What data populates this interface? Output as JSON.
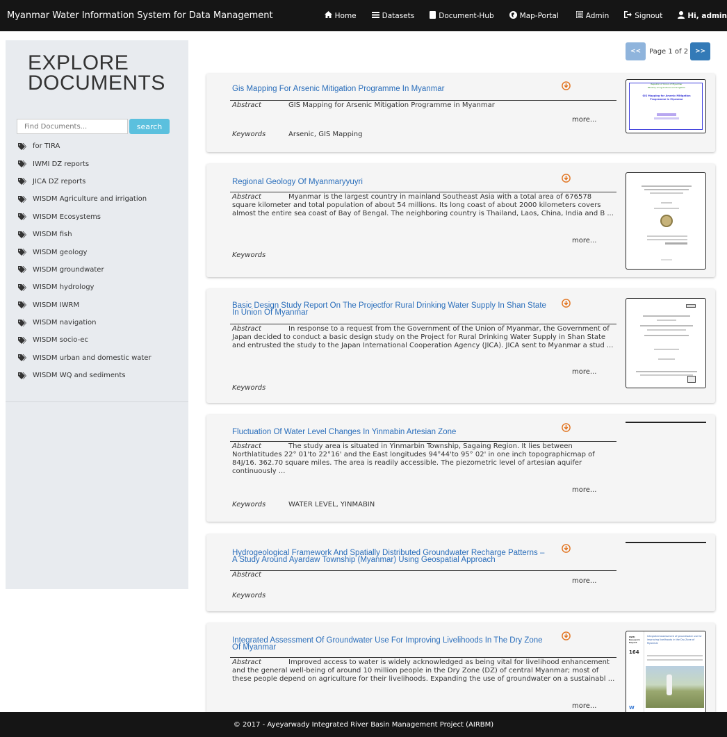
{
  "nav": {
    "brand": "Myanmar Water Information System for Data Management",
    "home": "Home",
    "datasets": "Datasets",
    "document_hub": "Document-Hub",
    "map_portal": "Map-Portal",
    "admin": "Admin",
    "signout": "Signout",
    "user": "Hi, admin"
  },
  "sidebar": {
    "title_line1": "EXPLORE",
    "title_line2": "DOCUMENTS",
    "search_placeholder": "Find Documents...",
    "search_label": "search",
    "tags": [
      "for TIRA",
      "IWMI DZ reports",
      "JICA DZ reports",
      "WISDM Agriculture and irrigation",
      "WISDM Ecosystems",
      "WISDM fish",
      "WISDM geology",
      "WISDM groundwater",
      "WISDM hydrology",
      "WISDM IWRM",
      "WISDM navigation",
      "WISDM socio-ec",
      "WISDM urban and domestic water",
      "WISDM WQ and sediments"
    ]
  },
  "pager": {
    "prev": "<<",
    "text": "Page 1 of 2",
    "next": ">>"
  },
  "labels": {
    "abstract": "Abstract",
    "keywords": "Keywords",
    "more": "more..."
  },
  "documents": [
    {
      "title": "Gis Mapping For Arsenic Mitigation Programme In Myanmar",
      "abstract": "GIS Mapping for Arsenic Mitigation Programme in Myanmar",
      "keywords": "Arsenic, GIS Mapping",
      "thumb_line1": "Republic of Union of Myanmar",
      "thumb_line2": "Ministry of Agriculture and Irrigation",
      "thumb_line3": "GIS Mapping for Arsenic Mitigation Programme in Myanmar"
    },
    {
      "title": "Regional Geology Of Myanmaryyuyri",
      "abstract": "Myanmar is the largest country in mainland Southeast Asia with a total area of 676578 square kilometer and total population of about 54 millions. Its long coast of about 2000 kilometers covers almost the entire sea coast of Bay of Bengal. The neighboring country is Thailand, Laos, China, India and B ...",
      "keywords": ""
    },
    {
      "title": "Basic Design Study Report On The Projectfor Rural Drinking Water Supply In Shan State In Union Of Myanmar",
      "abstract": "In response to a request from the Government of the Union of Myanmar, the Government of Japan decided to conduct a basic design study on the Project for Rural Drinking Water Supply in Shan State and entrusted the study to the Japan International Cooperation Agency (JICA). JICA sent to Myanmar a stud ...",
      "keywords": ""
    },
    {
      "title": "Fluctuation Of Water Level Changes In Yinmabin Artesian Zone",
      "abstract": "The study area is situated in Yinmarbin Township, Sagaing Region. It lies between Northlatitudes 22° 01'to 22°16' and the East longitudes 94°44'to 95° 02' in one inch topographicmap of 84J/16. 362.70 square miles. The area is readily accessible. The piezometric level of artesian aquifer continuously ...",
      "keywords": "WATER LEVEL, YINMABIN"
    },
    {
      "title": "Hydrogeological Framework And Spatially Distributed Groundwater Recharge Patterns – A Study Around Ayardaw Township (Myanmar) Using Geospatial Approach",
      "abstract": "",
      "keywords": ""
    },
    {
      "title": "Integrated Assessment Of Groundwater Use For Improving Livelihoods In The Dry Zone Of Myanmar",
      "abstract": "Improved access to water is widely acknowledged as being vital for livelihood enhancement and the general well-being of around 10 million people in the Dry Zone (DZ) of central Myanmar; most of these people depend on agriculture for their livelihoods. Expanding the use of groundwater on a sustainabl ...",
      "keywords": "",
      "thumb_line1": "Integrated assessment of groundwater use for improving livelihoods in the Dry Zone of Myanmar",
      "thumb_number": "164",
      "thumb_side": "IWMI Research Report"
    }
  ],
  "footer": {
    "text": "© 2017 - Ayeyarwady Integrated River Basin Management Project (AIRBM)"
  },
  "colors": {
    "navbar_bg": "#151515",
    "sidebar_bg": "#e8ebef",
    "link": "#2a6ebb",
    "search_btn": "#5bc0de",
    "pager_next": "#337ab7",
    "pager_prev": "#8fb4dc",
    "download_icon": "#e2731e"
  }
}
